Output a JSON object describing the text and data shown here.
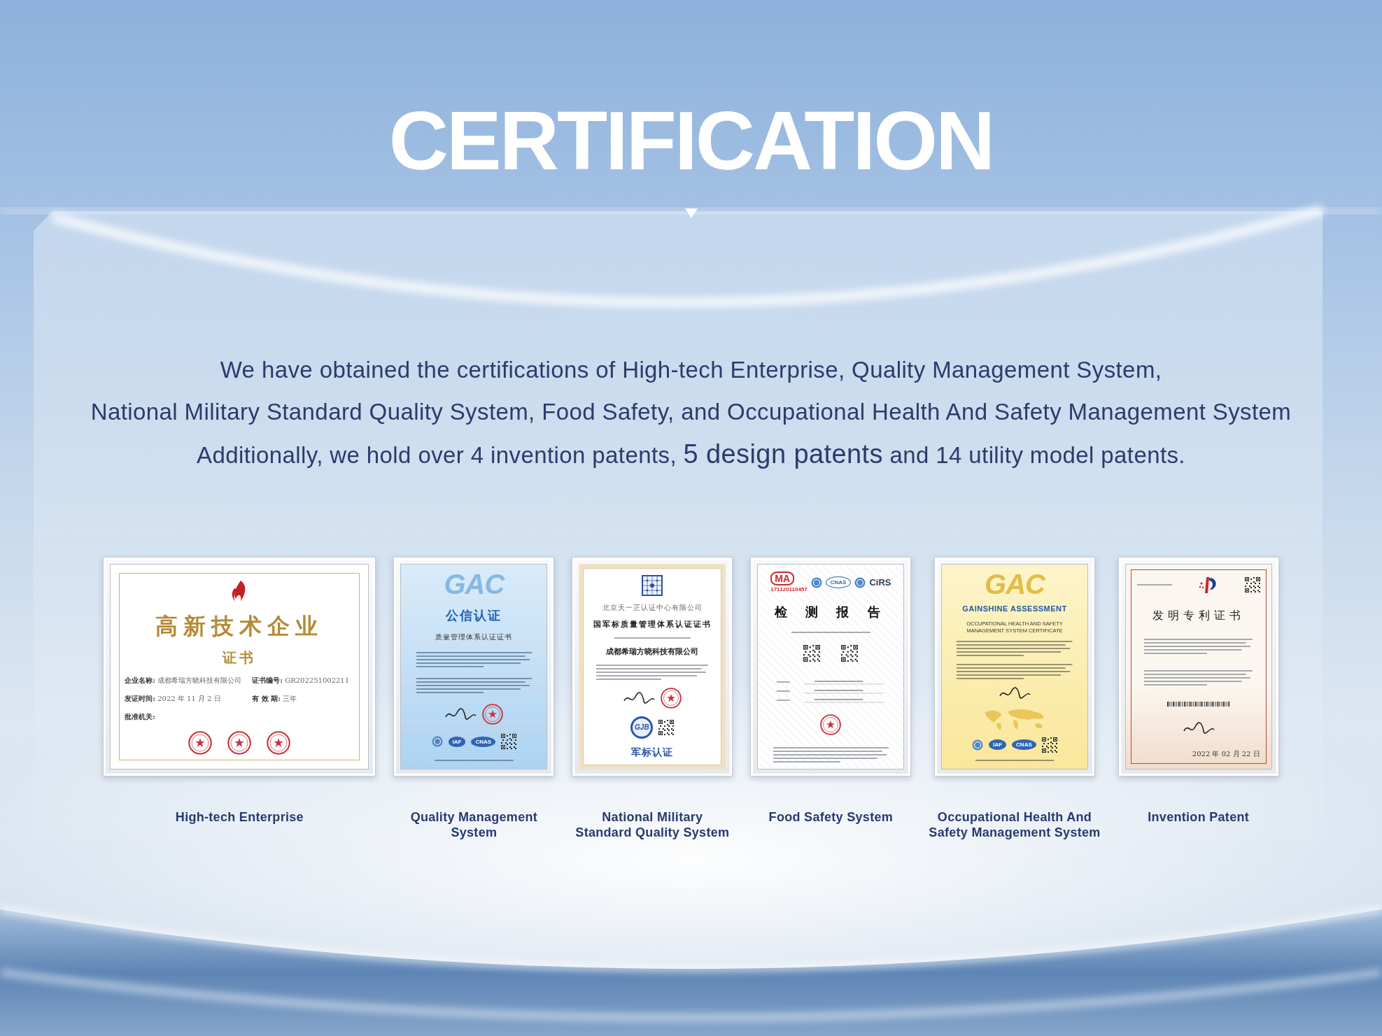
{
  "page": {
    "title": "CERTIFICATION",
    "intro": [
      [
        {
          "text": "We have obtained the certifications of High-tech Enterprise, Quality Management System,",
          "large": false
        }
      ],
      [
        {
          "text": "National Military Standard Quality System, Food Safety, and Occupational Health And Safety Management System",
          "large": false
        }
      ],
      [
        {
          "text": "Additionally, we hold over 4 invention patents, ",
          "large": false
        },
        {
          "text": "5 design patents",
          "large": true
        },
        {
          "text": " and 14 utility model patents.",
          "large": false
        }
      ]
    ]
  },
  "certificates": [
    {
      "kind": "award",
      "label": [
        "High-tech Enterprise"
      ],
      "rows": [
        [
          {
            "kind": "flame_logo"
          }
        ],
        [
          {
            "kind": "title",
            "text": "高新技术企业"
          }
        ],
        [
          {
            "kind": "subtitle",
            "text": "证书"
          }
        ],
        [
          {
            "kind": "field",
            "text": "**企业名称:** 成都希瑞方晓科技有限公司"
          },
          {
            "kind": "field",
            "text": "**证书编号:** GR202251002211"
          }
        ],
        [
          {
            "kind": "field",
            "text": "**发证时间:** 2022 年 11 月 2 日"
          },
          {
            "kind": "field",
            "text": "**有 效 期:** 三年"
          }
        ],
        [
          {
            "kind": "field",
            "text": "**批准机关:**"
          }
        ],
        [
          {
            "kind": "seal"
          },
          {
            "kind": "seal"
          },
          {
            "kind": "seal"
          }
        ]
      ]
    },
    {
      "kind": "quality",
      "label": [
        "Quality Management",
        "System"
      ],
      "rows": [
        [
          {
            "kind": "watermark",
            "text": "GAC"
          }
        ],
        [
          {
            "kind": "title",
            "text": "公信认证"
          }
        ],
        [
          {
            "kind": "heading",
            "text": "质量管理体系认证证书"
          }
        ],
        [
          {
            "kind": "fine_block"
          }
        ],
        [
          {
            "kind": "fine_block"
          }
        ],
        [
          {
            "kind": "signature"
          },
          {
            "kind": "seal"
          }
        ],
        [
          {
            "kind": "emblem"
          },
          {
            "kind": "logo",
            "text": "IAF"
          },
          {
            "kind": "logo",
            "text": "CNAS"
          },
          {
            "kind": "qr"
          }
        ],
        [
          {
            "kind": "fine_line"
          }
        ]
      ]
    },
    {
      "kind": "military",
      "label": [
        "National Military",
        "Standard Quality System"
      ],
      "rows": [
        [
          {
            "kind": "grid_logo"
          }
        ],
        [
          {
            "kind": "caption",
            "text": "北京天一正认证中心有限公司"
          }
        ],
        [
          {
            "kind": "heading",
            "text": "国军标质量管理体系认证证书"
          }
        ],
        [
          {
            "kind": "fine_line"
          }
        ],
        [
          {
            "kind": "name",
            "text": "成都希瑞方晓科技有限公司"
          }
        ],
        [
          {
            "kind": "fine_block"
          }
        ],
        [
          {
            "kind": "signature"
          },
          {
            "kind": "seal"
          }
        ],
        [
          {
            "kind": "round_logo",
            "text": "GJB"
          },
          {
            "kind": "qr"
          }
        ],
        [
          {
            "kind": "caption_strong",
            "text": "军标认证"
          }
        ]
      ]
    },
    {
      "kind": "report",
      "label": [
        "Food Safety System"
      ],
      "rows": [
        [
          {
            "kind": "ma_logo",
            "text": "MA",
            "number": "171120110457"
          },
          {
            "kind": "emblem"
          },
          {
            "kind": "logo",
            "text": "CNAS"
          },
          {
            "kind": "emblem"
          },
          {
            "kind": "brand",
            "text": "CiRS"
          }
        ],
        [
          {
            "kind": "title",
            "text": "检 测 报 告"
          }
        ],
        [
          {
            "kind": "fine_line"
          }
        ],
        [
          {
            "kind": "qr"
          },
          {
            "kind": "qr"
          }
        ],
        [
          {
            "kind": "form_lines"
          }
        ],
        [
          {
            "kind": "seal"
          }
        ],
        [
          {
            "kind": "fine_block"
          }
        ]
      ]
    },
    {
      "kind": "ohs",
      "label": [
        "Occupational Health And",
        "Safety Management System"
      ],
      "rows": [
        [
          {
            "kind": "watermark",
            "text": "GAC"
          }
        ],
        [
          {
            "kind": "heading",
            "text": "GAINSHINE ASSESSMENT"
          }
        ],
        [
          {
            "kind": "caption",
            "text": "OCCUPATIONAL HEALTH AND SAFETY MANAGEMENT SYSTEM CERTIFICATE"
          }
        ],
        [
          {
            "kind": "fine_block"
          }
        ],
        [
          {
            "kind": "fine_block"
          }
        ],
        [
          {
            "kind": "signature"
          }
        ],
        [
          {
            "kind": "map"
          }
        ],
        [
          {
            "kind": "emblem"
          },
          {
            "kind": "logo",
            "text": "IAF"
          },
          {
            "kind": "logo",
            "text": "CNAS"
          },
          {
            "kind": "qr"
          }
        ],
        [
          {
            "kind": "fine_line"
          }
        ]
      ]
    },
    {
      "kind": "patent",
      "label": [
        "Invention Patent"
      ],
      "rows": [
        [
          {
            "kind": "fine_line"
          },
          {
            "kind": "patent_logo"
          },
          {
            "kind": "qr"
          }
        ],
        [
          {
            "kind": "title",
            "text": "发明专利证书"
          }
        ],
        [
          {
            "kind": "fine_block"
          }
        ],
        [
          {
            "kind": "fine_block"
          }
        ],
        [
          {
            "kind": "barcode"
          }
        ],
        [
          {
            "kind": "signature"
          }
        ],
        [
          {
            "kind": "date",
            "text": "2022 年 02 月 22 日"
          }
        ]
      ]
    }
  ]
}
